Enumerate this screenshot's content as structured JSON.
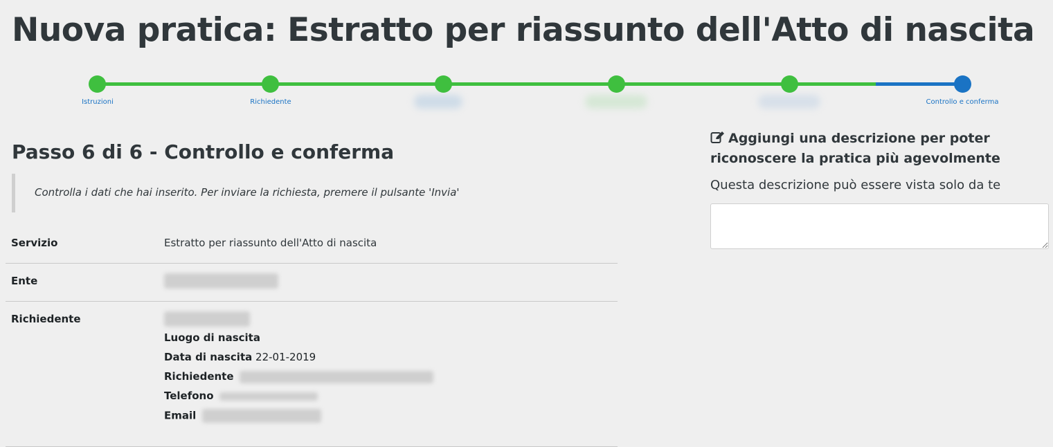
{
  "page": {
    "title": "Nuova pratica: Estratto per riassunto dell'Atto di nascita"
  },
  "stepper": {
    "steps": [
      {
        "label": "Istruzioni",
        "status": "done"
      },
      {
        "label": "Richiedente",
        "status": "done"
      },
      {
        "label": "",
        "status": "done"
      },
      {
        "label": "",
        "status": "done"
      },
      {
        "label": "",
        "status": "done"
      },
      {
        "label": "Controllo e conferma",
        "status": "current"
      }
    ],
    "colors": {
      "done": "#3fbf3f",
      "current": "#1a73c4"
    }
  },
  "main": {
    "step_heading": "Passo 6 di 6 - Controllo e conferma",
    "instruction": "Controlla i dati che hai inserito. Per inviare la richiesta, premere il pulsante 'Invia'",
    "summary": {
      "servizio_label": "Servizio",
      "servizio_value": "Estratto per riassunto dell'Atto di nascita",
      "ente_label": "Ente",
      "richiedente_label": "Richiedente",
      "luogo_label": "Luogo di nascita",
      "data_label": "Data di nascita",
      "data_value": "22-01-2019",
      "richiedente2_label": "Richiedente",
      "telefono_label": "Telefono",
      "email_label": "Email"
    }
  },
  "sidebar": {
    "description_title": "Aggiungi una descrizione per poter riconoscere la pratica più agevolmente",
    "description_subtitle": "Questa descrizione può essere vista solo da te",
    "description_value": ""
  }
}
